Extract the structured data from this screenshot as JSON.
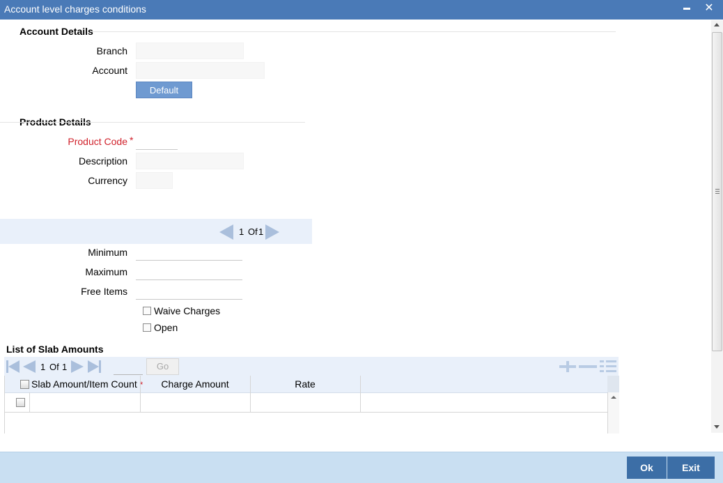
{
  "window": {
    "title": "Account level charges conditions",
    "minimize_glyph": "▬",
    "close_glyph": "✕"
  },
  "account_details": {
    "heading": "Account Details",
    "branch_label": "Branch",
    "branch_value": "",
    "account_label": "Account",
    "account_value": "",
    "default_button": "Default"
  },
  "product_details": {
    "heading": "Product Details",
    "product_code_label": "Product Code",
    "required_mark": "*",
    "product_code_value": "",
    "description_label": "Description",
    "description_value": "",
    "currency_label": "Currency",
    "currency_value": ""
  },
  "pager": {
    "current": "1",
    "of_label": "Of",
    "total": "1"
  },
  "limits": {
    "minimum_label": "Minimum",
    "minimum_value": "",
    "maximum_label": "Maximum",
    "maximum_value": "",
    "free_items_label": "Free Items",
    "free_items_value": "",
    "waive_charges_label": "Waive Charges",
    "waive_charges_checked": false,
    "open_label": "Open",
    "open_checked": false
  },
  "slab_list": {
    "heading": "List of Slab Amounts",
    "pager_current": "1",
    "pager_of": "Of",
    "pager_total": "1",
    "go_label": "Go",
    "columns": [
      {
        "label": "Slab Amount/Item Count",
        "required": "*"
      },
      {
        "label": "Charge Amount"
      },
      {
        "label": "Rate"
      }
    ],
    "rows": [
      {
        "slab_amount": "",
        "charge_amount": "",
        "rate": ""
      }
    ]
  },
  "footer": {
    "ok_label": "Ok",
    "exit_label": "Exit"
  },
  "colors": {
    "title_bar": "#4a7ab7",
    "required": "#d0202a",
    "footer": "#c9dff2",
    "footer_buttons": "#3c6ea6",
    "band": "#e9f0fa"
  }
}
